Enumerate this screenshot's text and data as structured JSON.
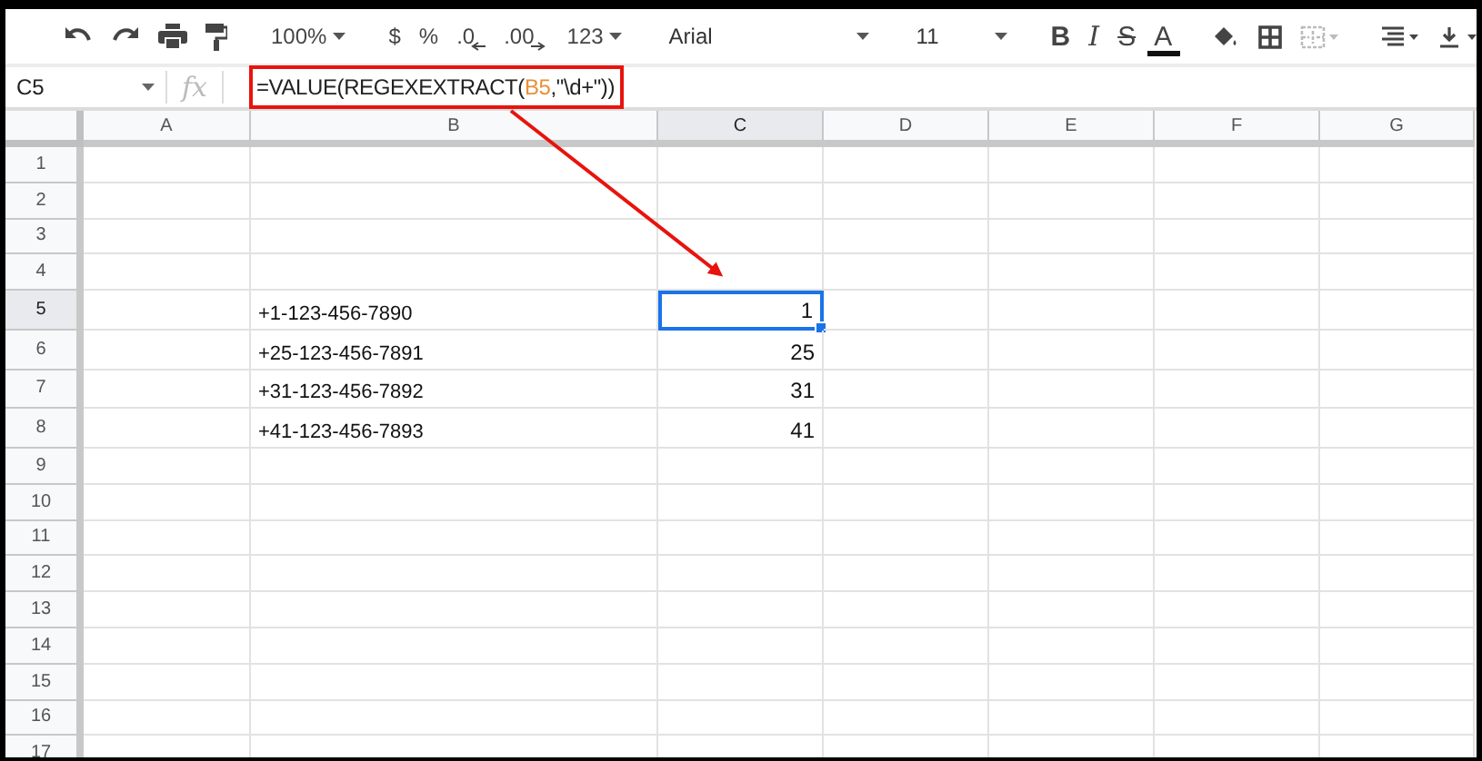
{
  "toolbar": [
    {
      "kind": "undo"
    },
    {
      "kind": "redo"
    },
    {
      "kind": "print"
    },
    {
      "kind": "paint"
    },
    {
      "kind": "sep"
    },
    {
      "kind": "dropdown",
      "label": "100%"
    },
    {
      "kind": "sep"
    },
    {
      "kind": "text",
      "label": "$"
    },
    {
      "kind": "text",
      "label": "%"
    },
    {
      "kind": "decimal-less",
      "label": ".0"
    },
    {
      "kind": "decimal-more",
      "label": ".00"
    },
    {
      "kind": "dropdown",
      "label": "123"
    },
    {
      "kind": "sep"
    },
    {
      "kind": "font",
      "label": "Arial"
    },
    {
      "kind": "sep"
    },
    {
      "kind": "size",
      "label": "11"
    },
    {
      "kind": "sep"
    },
    {
      "kind": "bold",
      "label": "B"
    },
    {
      "kind": "italic",
      "label": "I"
    },
    {
      "kind": "strike",
      "label": "S"
    },
    {
      "kind": "color",
      "label": "A"
    },
    {
      "kind": "sep"
    },
    {
      "kind": "fill"
    },
    {
      "kind": "borders"
    },
    {
      "kind": "merge"
    },
    {
      "kind": "sep"
    },
    {
      "kind": "halign"
    },
    {
      "kind": "valign"
    }
  ],
  "formula_bar": {
    "name_box": "C5",
    "function_label": "fx",
    "formula": [
      {
        "kind": "plain",
        "text": "=VALUE(REGEXEXTRACT("
      },
      {
        "kind": "ref",
        "text": "B5"
      },
      {
        "kind": "plain",
        "text": ",\"\\d+\"))"
      }
    ]
  },
  "columns": [
    {
      "label": "A",
      "selected": false
    },
    {
      "label": "B",
      "selected": false
    },
    {
      "label": "C",
      "selected": true
    },
    {
      "label": "D",
      "selected": false
    },
    {
      "label": "E",
      "selected": false
    },
    {
      "label": "F",
      "selected": false
    },
    {
      "label": "G",
      "selected": false
    }
  ],
  "rows": [
    {
      "header": "1",
      "selected": false
    },
    {
      "header": "2",
      "selected": false
    },
    {
      "header": "3",
      "selected": false
    },
    {
      "header": "4",
      "selected": false
    },
    {
      "header": "5",
      "selected": true,
      "phone": "+1-123-456-7890",
      "value": "1"
    },
    {
      "header": "6",
      "selected": false,
      "phone": "+25-123-456-7891",
      "value": "25"
    },
    {
      "header": "7",
      "selected": false,
      "phone": "+31-123-456-7892",
      "value": "31"
    },
    {
      "header": "8",
      "selected": false,
      "phone": "+41-123-456-7893",
      "value": "41"
    },
    {
      "header": "9",
      "selected": false
    },
    {
      "header": "10",
      "selected": false
    },
    {
      "header": "11",
      "selected": false
    },
    {
      "header": "12",
      "selected": false
    },
    {
      "header": "13",
      "selected": false
    },
    {
      "header": "14",
      "selected": false
    },
    {
      "header": "15",
      "selected": false
    },
    {
      "header": "16",
      "selected": false
    },
    {
      "header": "17",
      "selected": false
    }
  ]
}
